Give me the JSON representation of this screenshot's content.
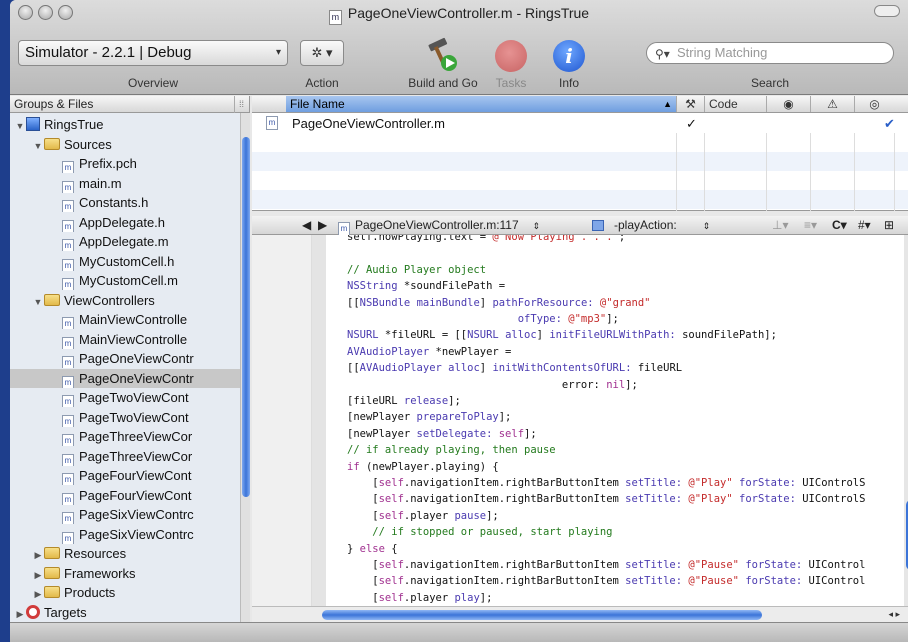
{
  "window": {
    "title": "PageOneViewController.m - RingsTrue",
    "doc_icon": "m"
  },
  "toolbar": {
    "overview_select": "Simulator - 2.2.1 | Debug",
    "overview_label": "Overview",
    "action_glyph": "✲ ▾",
    "action_label": "Action",
    "build_label": "Build and Go",
    "tasks_label": "Tasks",
    "info_label": "Info",
    "info_glyph": "i",
    "search_placeholder": "String Matching",
    "search_label": "Search"
  },
  "sidebar": {
    "header": "Groups & Files",
    "items": [
      {
        "label": "RingsTrue",
        "depth": 0,
        "icon": "project-icon",
        "expanded": true
      },
      {
        "label": "Sources",
        "depth": 1,
        "icon": "folder-icon",
        "expanded": true
      },
      {
        "label": "Prefix.pch",
        "depth": 2,
        "icon": "source-file-icon"
      },
      {
        "label": "main.m",
        "depth": 2,
        "icon": "source-file-icon"
      },
      {
        "label": "Constants.h",
        "depth": 2,
        "icon": "source-file-icon"
      },
      {
        "label": "AppDelegate.h",
        "depth": 2,
        "icon": "source-file-icon"
      },
      {
        "label": "AppDelegate.m",
        "depth": 2,
        "icon": "source-file-icon"
      },
      {
        "label": "MyCustomCell.h",
        "depth": 2,
        "icon": "source-file-icon"
      },
      {
        "label": "MyCustomCell.m",
        "depth": 2,
        "icon": "source-file-icon"
      },
      {
        "label": "ViewControllers",
        "depth": 1,
        "icon": "folder-icon",
        "expanded": true
      },
      {
        "label": "MainViewControlle",
        "depth": 2,
        "icon": "source-file-icon"
      },
      {
        "label": "MainViewControlle",
        "depth": 2,
        "icon": "source-file-icon"
      },
      {
        "label": "PageOneViewContr",
        "depth": 2,
        "icon": "source-file-icon"
      },
      {
        "label": "PageOneViewContr",
        "depth": 2,
        "icon": "source-file-icon",
        "selected": true
      },
      {
        "label": "PageTwoViewCont",
        "depth": 2,
        "icon": "source-file-icon"
      },
      {
        "label": "PageTwoViewCont",
        "depth": 2,
        "icon": "source-file-icon"
      },
      {
        "label": "PageThreeViewCor",
        "depth": 2,
        "icon": "source-file-icon"
      },
      {
        "label": "PageThreeViewCor",
        "depth": 2,
        "icon": "source-file-icon"
      },
      {
        "label": "PageFourViewCont",
        "depth": 2,
        "icon": "source-file-icon"
      },
      {
        "label": "PageFourViewCont",
        "depth": 2,
        "icon": "source-file-icon"
      },
      {
        "label": "PageSixViewContrc",
        "depth": 2,
        "icon": "source-file-icon"
      },
      {
        "label": "PageSixViewContrc",
        "depth": 2,
        "icon": "source-file-icon"
      },
      {
        "label": "Resources",
        "depth": 1,
        "icon": "folder-icon",
        "expanded": false
      },
      {
        "label": "Frameworks",
        "depth": 1,
        "icon": "folder-icon",
        "expanded": false
      },
      {
        "label": "Products",
        "depth": 1,
        "icon": "folder-icon",
        "expanded": false
      },
      {
        "label": "Targets",
        "depth": 0,
        "icon": "target-icon",
        "expanded": false
      }
    ]
  },
  "file_list": {
    "columns": {
      "file_name": "File Name",
      "code": "Code"
    },
    "rows": [
      {
        "name": "PageOneViewController.m",
        "code_check": "✓",
        "target_check": "✔"
      }
    ]
  },
  "editor_nav": {
    "file_popup": "PageOneViewController.m:117",
    "method_popup": "-playAction:"
  },
  "code_lines": [
    {
      "segments": [
        [
          "",
          "self.nowPlaying.text = "
        ],
        [
          "s",
          "@\"Now Playing . . .\""
        ],
        [
          "",
          ";"
        ]
      ]
    },
    {
      "segments": []
    },
    {
      "segments": [
        [
          "c",
          "// Audio Player object"
        ]
      ]
    },
    {
      "segments": [
        [
          "t",
          "NSString"
        ],
        [
          "",
          " *soundFilePath ="
        ]
      ]
    },
    {
      "segments": [
        [
          "",
          "[["
        ],
        [
          "t",
          "NSBundle"
        ],
        [
          "",
          " "
        ],
        [
          "t",
          "mainBundle"
        ],
        [
          "",
          "] "
        ],
        [
          "t",
          "pathForResource:"
        ],
        [
          "",
          " "
        ],
        [
          "s",
          "@\"grand\""
        ]
      ]
    },
    {
      "segments": [
        [
          "",
          "                           "
        ],
        [
          "t",
          "ofType:"
        ],
        [
          "",
          " "
        ],
        [
          "s",
          "@\"mp3\""
        ],
        [
          "",
          "];"
        ]
      ]
    },
    {
      "segments": [
        [
          "t",
          "NSURL"
        ],
        [
          "",
          " *fileURL = [["
        ],
        [
          "t",
          "NSURL"
        ],
        [
          "",
          " "
        ],
        [
          "t",
          "alloc"
        ],
        [
          "",
          "] "
        ],
        [
          "t",
          "initFileURLWithPath:"
        ],
        [
          "",
          " soundFilePath];"
        ]
      ]
    },
    {
      "segments": [
        [
          "t",
          "AVAudioPlayer"
        ],
        [
          "",
          " *newPlayer ="
        ]
      ]
    },
    {
      "segments": [
        [
          "",
          "[["
        ],
        [
          "t",
          "AVAudioPlayer"
        ],
        [
          "",
          " "
        ],
        [
          "t",
          "alloc"
        ],
        [
          "",
          "] "
        ],
        [
          "t",
          "initWithContentsOfURL:"
        ],
        [
          "",
          " fileURL"
        ]
      ]
    },
    {
      "segments": [
        [
          "",
          "                                  error: "
        ],
        [
          "k",
          "nil"
        ],
        [
          "",
          "];"
        ]
      ]
    },
    {
      "segments": [
        [
          "",
          "[fileURL "
        ],
        [
          "t",
          "release"
        ],
        [
          "",
          "];"
        ]
      ]
    },
    {
      "segments": [
        [
          "",
          "[newPlayer "
        ],
        [
          "t",
          "prepareToPlay"
        ],
        [
          "",
          "];"
        ]
      ]
    },
    {
      "segments": [
        [
          "",
          "[newPlayer "
        ],
        [
          "t",
          "setDelegate:"
        ],
        [
          "",
          " "
        ],
        [
          "k",
          "self"
        ],
        [
          "",
          "];"
        ]
      ]
    },
    {
      "segments": [
        [
          "c",
          "// if already playing, then pause"
        ]
      ]
    },
    {
      "segments": [
        [
          "k",
          "if"
        ],
        [
          "",
          " (newPlayer.playing) {"
        ]
      ]
    },
    {
      "segments": [
        [
          "",
          "    ["
        ],
        [
          "k",
          "self"
        ],
        [
          "",
          ".navigationItem.rightBarButtonItem "
        ],
        [
          "t",
          "setTitle:"
        ],
        [
          "",
          " "
        ],
        [
          "s",
          "@\"Play\""
        ],
        [
          "",
          " "
        ],
        [
          "t",
          "forState:"
        ],
        [
          "",
          " UIControlS"
        ]
      ]
    },
    {
      "segments": [
        [
          "",
          "    ["
        ],
        [
          "k",
          "self"
        ],
        [
          "",
          ".navigationItem.rightBarButtonItem "
        ],
        [
          "t",
          "setTitle:"
        ],
        [
          "",
          " "
        ],
        [
          "s",
          "@\"Play\""
        ],
        [
          "",
          " "
        ],
        [
          "t",
          "forState:"
        ],
        [
          "",
          " UIControlS"
        ]
      ]
    },
    {
      "segments": [
        [
          "",
          "    ["
        ],
        [
          "k",
          "self"
        ],
        [
          "",
          ".player "
        ],
        [
          "t",
          "pause"
        ],
        [
          "",
          "];"
        ]
      ]
    },
    {
      "segments": [
        [
          "c",
          "    // if stopped or paused, start playing"
        ]
      ]
    },
    {
      "segments": [
        [
          "",
          "} "
        ],
        [
          "k",
          "else"
        ],
        [
          "",
          " {"
        ]
      ]
    },
    {
      "segments": [
        [
          "",
          "    ["
        ],
        [
          "k",
          "self"
        ],
        [
          "",
          ".navigationItem.rightBarButtonItem "
        ],
        [
          "t",
          "setTitle:"
        ],
        [
          "",
          " "
        ],
        [
          "s",
          "@\"Pause\""
        ],
        [
          "",
          " "
        ],
        [
          "t",
          "forState:"
        ],
        [
          "",
          " UIControl"
        ]
      ]
    },
    {
      "segments": [
        [
          "",
          "    ["
        ],
        [
          "k",
          "self"
        ],
        [
          "",
          ".navigationItem.rightBarButtonItem "
        ],
        [
          "t",
          "setTitle:"
        ],
        [
          "",
          " "
        ],
        [
          "s",
          "@\"Pause\""
        ],
        [
          "",
          " "
        ],
        [
          "t",
          "forState:"
        ],
        [
          "",
          " UIControl"
        ]
      ]
    },
    {
      "segments": [
        [
          "",
          "    ["
        ],
        [
          "k",
          "self"
        ],
        [
          "",
          ".player "
        ],
        [
          "t",
          "play"
        ],
        [
          "",
          "];"
        ]
      ]
    }
  ],
  "colors": {
    "accent": "#3b74d8",
    "selection": "#c8c8c8",
    "desktop": "#1e3e8c"
  }
}
